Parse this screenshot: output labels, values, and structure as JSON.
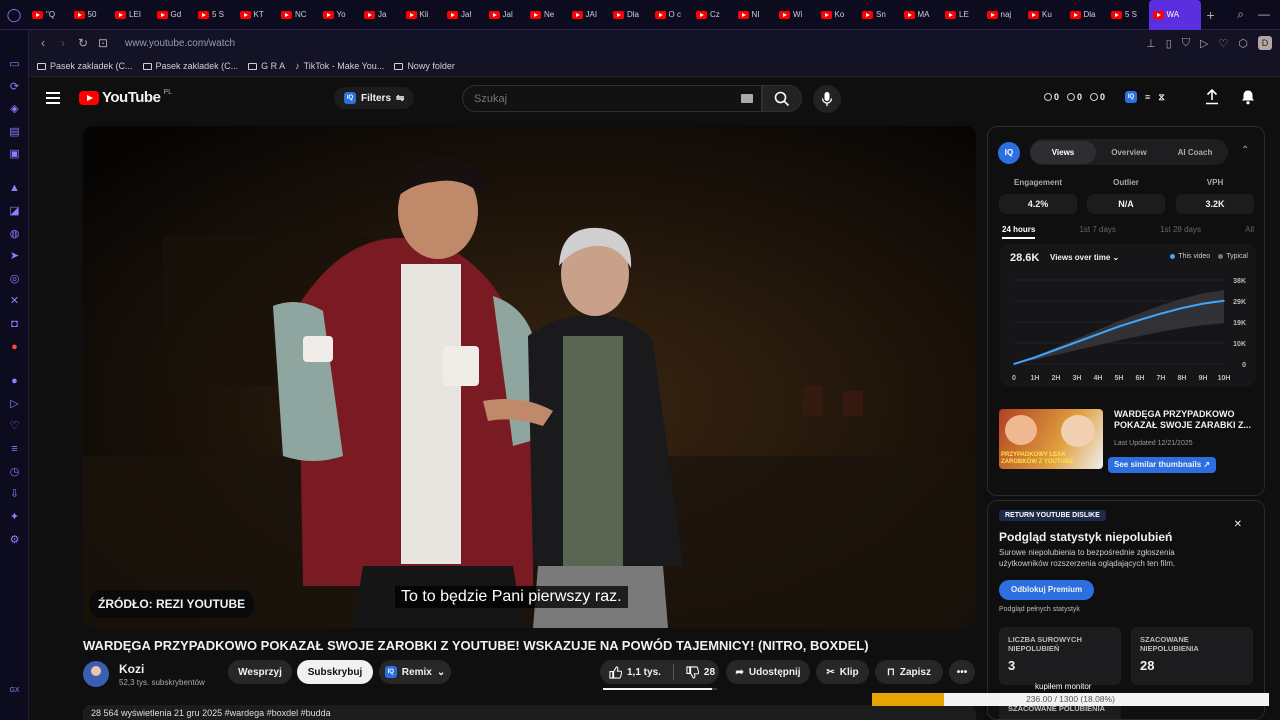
{
  "browser": {
    "tabs": [
      "\"Q",
      "50",
      "LEI",
      "Gd",
      "5 S",
      "KT",
      "NC",
      "Yo",
      "Ja",
      "Kli",
      "Jal",
      "Jal",
      "Ne",
      "JAI",
      "Dla",
      "O c",
      "Cz",
      "NI",
      "Wi",
      "Ko",
      "Sn",
      "MA",
      "LE",
      "naj",
      "Ku",
      "Dla",
      "5 S"
    ],
    "active_tab": "WA",
    "url": "www.youtube.com/watch",
    "bookmarks": [
      "Pasek zakladek (C...",
      "Pasek zakladek (C...",
      "G R A",
      "TikTok - Make You...",
      "Nowy folder"
    ]
  },
  "header": {
    "brand": "YouTube",
    "country": "PL",
    "filters_label": "Filters",
    "search_placeholder": "Szukaj",
    "stats": [
      "0",
      "0",
      "0"
    ]
  },
  "video": {
    "source_badge": "ŹRÓDŁO: REZI YOUTUBE",
    "subtitle": "To to będzie Pani pierwszy raz.",
    "title": "WARDĘGA PRZYPADKOWO POKAZAŁ SWOJE ZAROBKI Z YOUTUBE! WSKAZUJE NA POWÓD TAJEMNICY! (NITRO, BOXDEL)",
    "channel": "Kozi",
    "subscribers": "52,3 tys. subskrybentów",
    "support_label": "Wesprzyj",
    "subscribe_label": "Subskrybuj",
    "remix_label": "Remix",
    "likes": "1,1 tys.",
    "dislikes": "28",
    "share_label": "Udostępnij",
    "clip_label": "Klip",
    "save_label": "Zapisz",
    "description_preview": "28 564 wyświetlenia  21 gru 2025  #wardega #boxdel #budda"
  },
  "analytics": {
    "tabs": [
      "Views",
      "Overview",
      "AI Coach"
    ],
    "active_tab": "Views",
    "metrics": [
      {
        "label": "Engagement",
        "value": "4.2%"
      },
      {
        "label": "Outlier",
        "value": "N/A"
      },
      {
        "label": "VPH",
        "value": "3.2K"
      }
    ],
    "ranges": [
      "24 hours",
      "1st 7 days",
      "1st 28 days",
      "All"
    ],
    "active_range": "24 hours",
    "total": "28.6K",
    "metric_select": "Views over time",
    "legend": [
      {
        "name": "This video",
        "color": "#3ea6ff"
      },
      {
        "name": "Typical",
        "color": "#777777"
      }
    ],
    "similar": {
      "title": "WARDĘGA PRZYPADKOWO POKAZAŁ SWOJE ZARABKI Z...",
      "date": "Last Updated 12/21/2025",
      "button": "See similar thumbnails ↗",
      "thumb_caption": "PRZYPADKOWY LEAK ZAROBKÓW Z YOUTUBE"
    }
  },
  "chart_data": {
    "type": "area",
    "x": [
      "0",
      "1H",
      "2H",
      "3H",
      "4H",
      "5H",
      "6H",
      "7H",
      "8H",
      "9H",
      "10H"
    ],
    "y_ticks": [
      "38K",
      "29K",
      "19K",
      "10K",
      "0"
    ],
    "ylim": [
      0,
      38000
    ],
    "series": [
      {
        "name": "This video",
        "values": [
          0,
          3000,
          6500,
          10000,
          13500,
          17000,
          20000,
          22800,
          25300,
          27300,
          28600
        ]
      },
      {
        "name": "Typical",
        "values": [
          0,
          3500,
          7500,
          11500,
          15500,
          19500,
          23000,
          26500,
          29500,
          32000,
          33500
        ]
      }
    ]
  },
  "ryd": {
    "badge": "RETURN YOUTUBE DISLIKE",
    "heading": "Podgląd statystyk niepolubień",
    "text": "Surowe niepolubienia to bezpośrednie zgłoszenia użytkowników rozszerzenia oglądających ten film.",
    "button": "Odblokuj Premium",
    "link": "Podgląd pełnych statystyk",
    "cards": [
      {
        "label": "LICZBA SUROWYCH NIEPOLUBIEŃ",
        "value": "3"
      },
      {
        "label": "SZACOWANE NIEPOLUBIENIA",
        "value": "28"
      }
    ],
    "card3": "SZACOWANE POLUBIENIA"
  },
  "overlay": {
    "label": "kupiłem monitor",
    "progress_text": "236.00 / 1300 (18.08%)",
    "progress_fraction": 0.1808
  }
}
